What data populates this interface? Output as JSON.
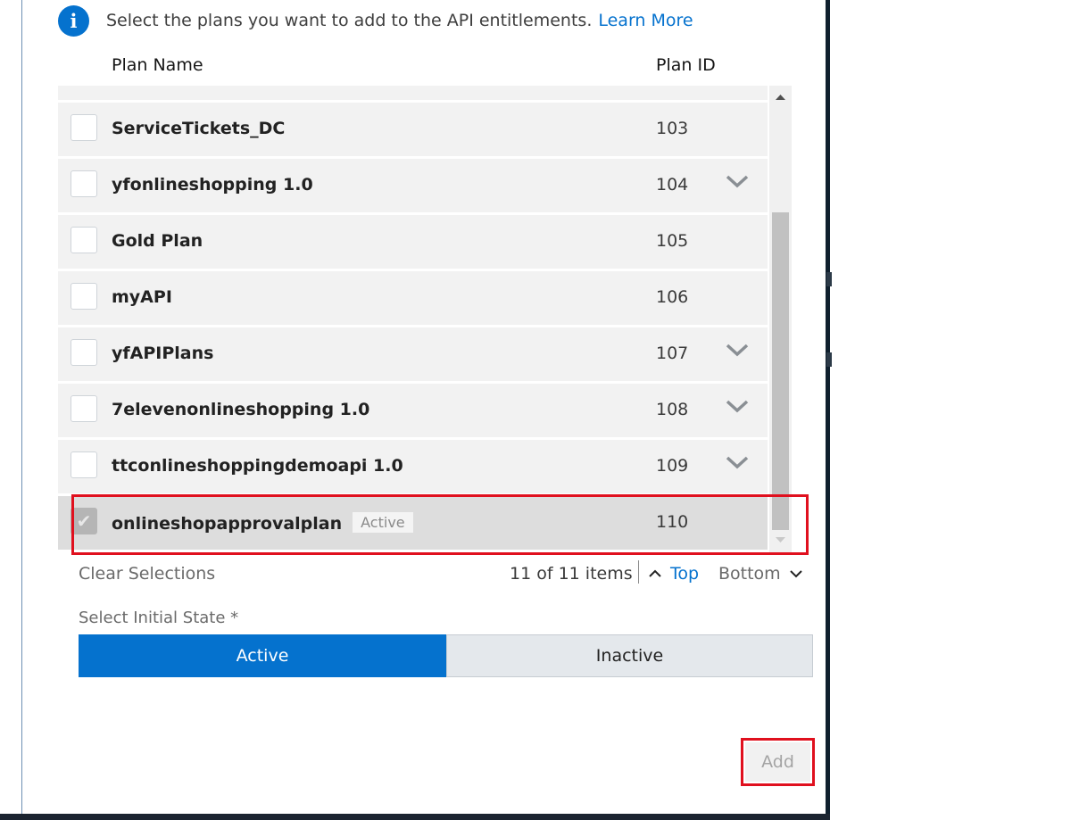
{
  "info": {
    "message": "Select the plans you want to add to the API entitlements.",
    "link": "Learn More"
  },
  "table": {
    "headers": [
      "Plan Name",
      "Plan ID"
    ],
    "rows": [
      {
        "name": "ServiceTickets_DC",
        "id": "103",
        "expandable": false,
        "checked": false
      },
      {
        "name": "yfonlineshopping 1.0",
        "id": "104",
        "expandable": true,
        "checked": false
      },
      {
        "name": "Gold Plan",
        "id": "105",
        "expandable": false,
        "checked": false
      },
      {
        "name": "myAPI",
        "id": "106",
        "expandable": false,
        "checked": false
      },
      {
        "name": "yfAPIPlans",
        "id": "107",
        "expandable": true,
        "checked": false
      },
      {
        "name": "7elevenonlineshopping 1.0",
        "id": "108",
        "expandable": true,
        "checked": false
      },
      {
        "name": "ttconlineshoppingdemoapi 1.0",
        "id": "109",
        "expandable": true,
        "checked": false
      },
      {
        "name": "onlineshopapprovalplan",
        "id": "110",
        "badge": "Active",
        "expandable": false,
        "checked": true
      }
    ]
  },
  "footer": {
    "clear": "Clear Selections",
    "count": "11 of 11 items",
    "top": "Top",
    "bottom": "Bottom"
  },
  "state": {
    "label": "Select Initial State *",
    "options": [
      "Active",
      "Inactive"
    ],
    "selected": "Active"
  },
  "actions": {
    "add": "Add"
  },
  "colors": {
    "accent": "#0572ce",
    "highlight": "#e0101e"
  }
}
